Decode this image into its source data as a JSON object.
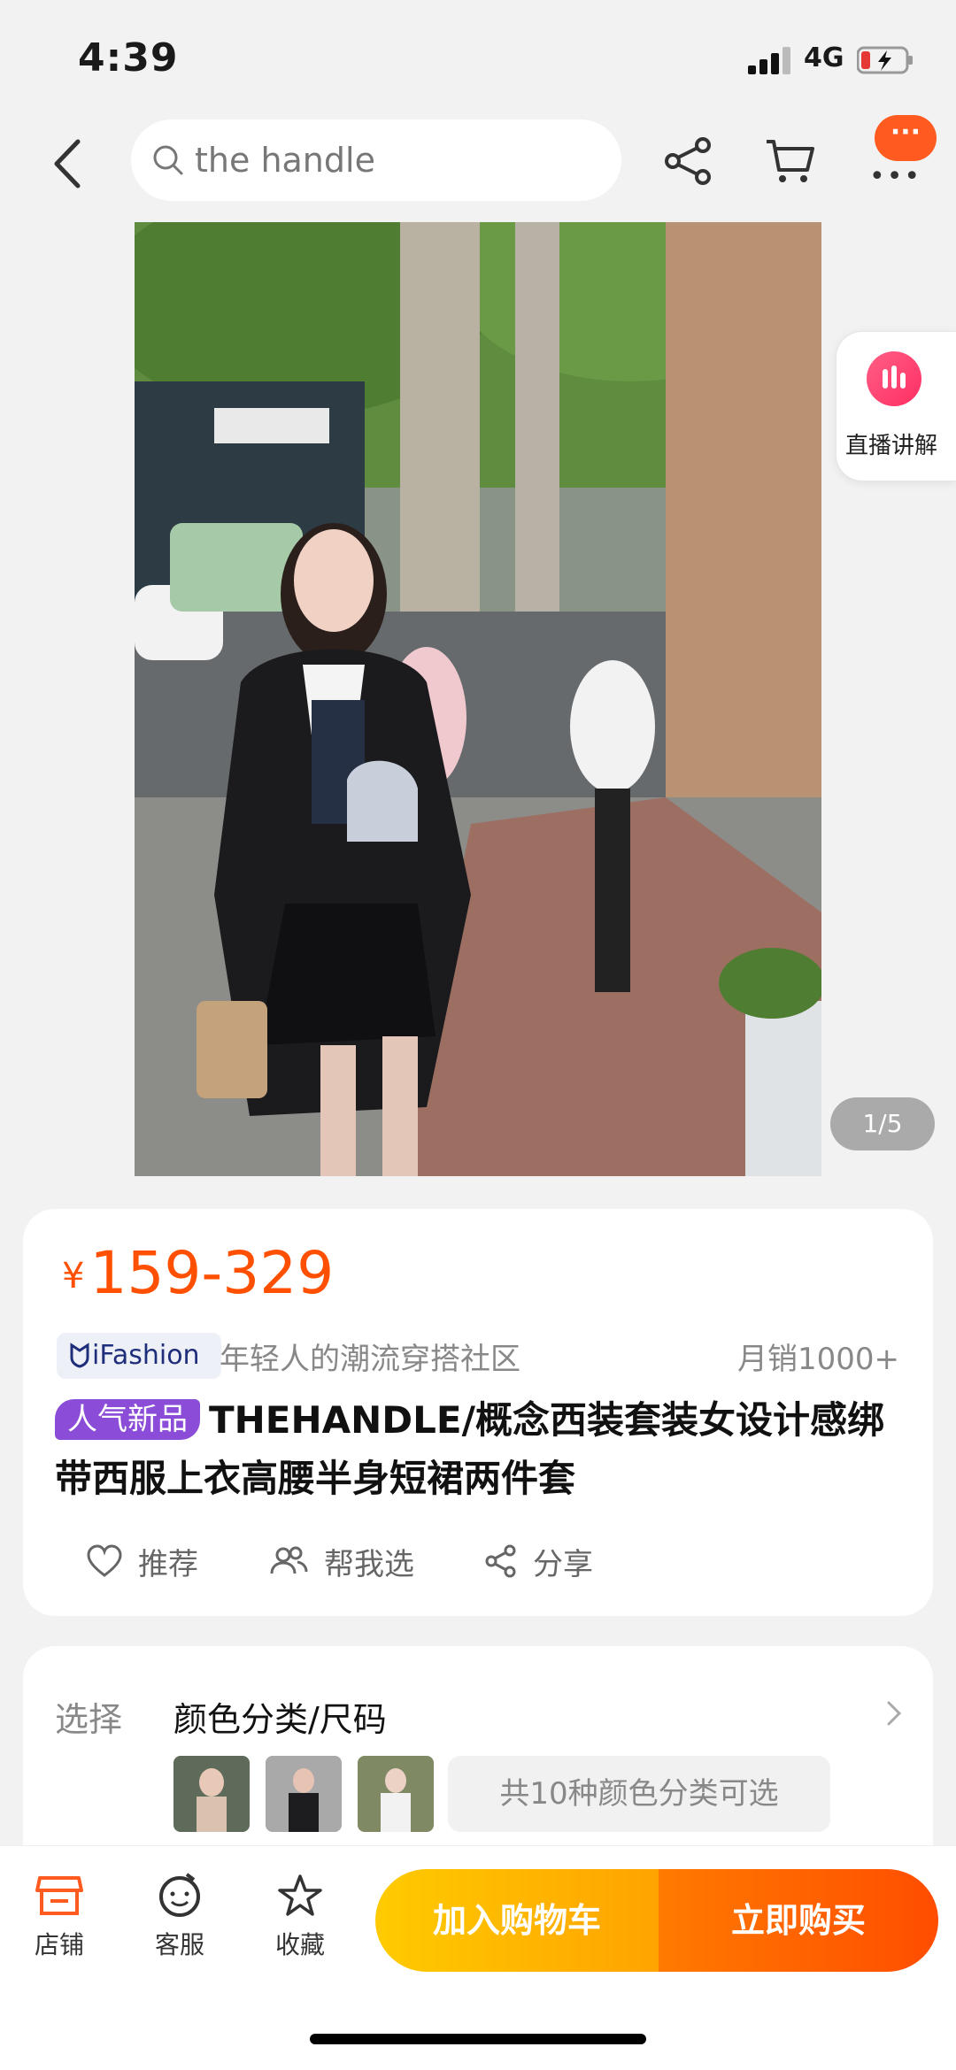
{
  "status_bar": {
    "time": "4:39",
    "network": "4G"
  },
  "search": {
    "query": "the handle"
  },
  "more": {
    "badge": "···",
    "dots": "•••"
  },
  "live": {
    "label": "直播讲解"
  },
  "gallery": {
    "indicator": "1/5",
    "current": 1,
    "total": 5
  },
  "price": {
    "currency": "¥",
    "range": "159-329",
    "color": "#ff4f00"
  },
  "brand": {
    "logo_text": "iFashion",
    "tagline": "年轻人的潮流穿搭社区",
    "monthly_sales": "月销1000+"
  },
  "product": {
    "badge": "人气新品",
    "title": "THEHANDLE/概念西装套装女设计感绑带西服上衣高腰半身短裙两件套"
  },
  "actions": [
    {
      "label": "推荐",
      "icon": "heart-icon"
    },
    {
      "label": "帮我选",
      "icon": "people-icon"
    },
    {
      "label": "分享",
      "icon": "share-icon"
    }
  ],
  "selection": {
    "label": "选择",
    "value": "颜色分类/尺码",
    "variant_count": "共10种颜色分类可选"
  },
  "bottom_bar": {
    "tabs": [
      {
        "label": "店铺",
        "icon": "store-icon"
      },
      {
        "label": "客服",
        "icon": "customer-service-icon"
      },
      {
        "label": "收藏",
        "icon": "star-icon"
      }
    ],
    "add_to_cart": "加入购物车",
    "buy_now": "立即购买"
  },
  "colors": {
    "accent": "#ff5a1f",
    "badge": "#8b4cd8",
    "cart_button": "#ffb400",
    "buy_button": "#ff5a00"
  }
}
